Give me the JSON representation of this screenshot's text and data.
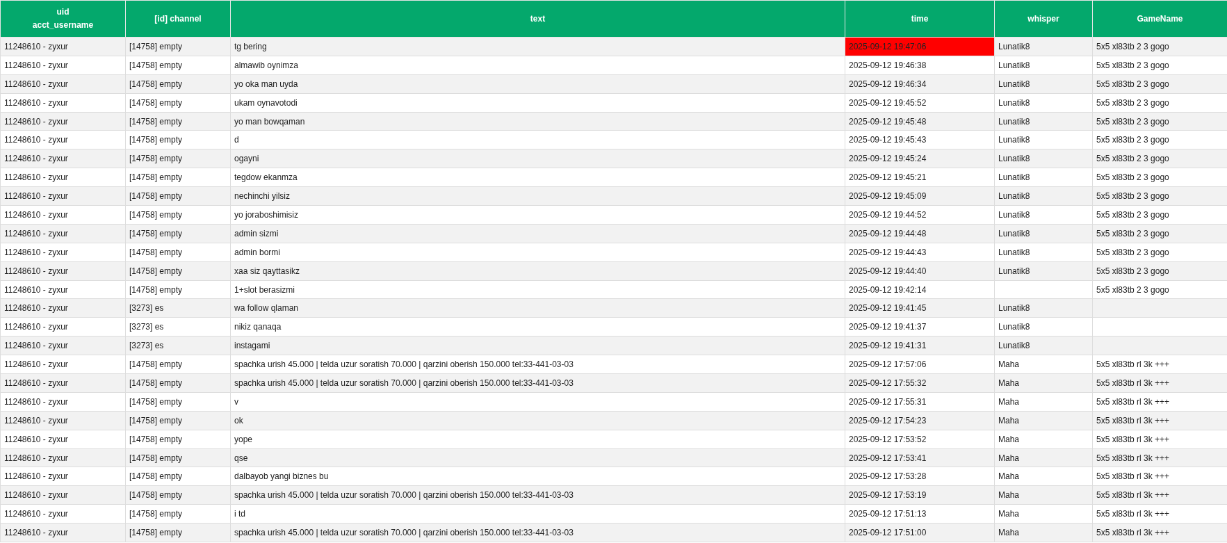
{
  "table": {
    "columns": [
      "uid\nacct_username",
      "[id] channel",
      "text",
      "time",
      "whisper",
      "GameName"
    ],
    "rows": [
      {
        "uid": "11248610 - zyxur",
        "channel": "[14758] empty",
        "text": "tg bering",
        "time": "2025-09-12 19:47:06",
        "time_flagged": true,
        "whisper": "Lunatik8",
        "game": "5x5 xl83tb 2 3 gogo"
      },
      {
        "uid": "11248610 - zyxur",
        "channel": "[14758] empty",
        "text": "almawib oynimza",
        "time": "2025-09-12 19:46:38",
        "time_flagged": false,
        "whisper": "Lunatik8",
        "game": "5x5 xl83tb 2 3 gogo"
      },
      {
        "uid": "11248610 - zyxur",
        "channel": "[14758] empty",
        "text": "yo oka man uyda",
        "time": "2025-09-12 19:46:34",
        "time_flagged": false,
        "whisper": "Lunatik8",
        "game": "5x5 xl83tb 2 3 gogo"
      },
      {
        "uid": "11248610 - zyxur",
        "channel": "[14758] empty",
        "text": "ukam oynavotodi",
        "time": "2025-09-12 19:45:52",
        "time_flagged": false,
        "whisper": "Lunatik8",
        "game": "5x5 xl83tb 2 3 gogo"
      },
      {
        "uid": "11248610 - zyxur",
        "channel": "[14758] empty",
        "text": "yo man bowqaman",
        "time": "2025-09-12 19:45:48",
        "time_flagged": false,
        "whisper": "Lunatik8",
        "game": "5x5 xl83tb 2 3 gogo"
      },
      {
        "uid": "11248610 - zyxur",
        "channel": "[14758] empty",
        "text": "d",
        "time": "2025-09-12 19:45:43",
        "time_flagged": false,
        "whisper": "Lunatik8",
        "game": "5x5 xl83tb 2 3 gogo"
      },
      {
        "uid": "11248610 - zyxur",
        "channel": "[14758] empty",
        "text": "ogayni",
        "time": "2025-09-12 19:45:24",
        "time_flagged": false,
        "whisper": "Lunatik8",
        "game": "5x5 xl83tb 2 3 gogo"
      },
      {
        "uid": "11248610 - zyxur",
        "channel": "[14758] empty",
        "text": "tegdow ekanmza",
        "time": "2025-09-12 19:45:21",
        "time_flagged": false,
        "whisper": "Lunatik8",
        "game": "5x5 xl83tb 2 3 gogo"
      },
      {
        "uid": "11248610 - zyxur",
        "channel": "[14758] empty",
        "text": "nechinchi yilsiz",
        "time": "2025-09-12 19:45:09",
        "time_flagged": false,
        "whisper": "Lunatik8",
        "game": "5x5 xl83tb 2 3 gogo"
      },
      {
        "uid": "11248610 - zyxur",
        "channel": "[14758] empty",
        "text": "yo joraboshimisiz",
        "time": "2025-09-12 19:44:52",
        "time_flagged": false,
        "whisper": "Lunatik8",
        "game": "5x5 xl83tb 2 3 gogo"
      },
      {
        "uid": "11248610 - zyxur",
        "channel": "[14758] empty",
        "text": "admin sizmi",
        "time": "2025-09-12 19:44:48",
        "time_flagged": false,
        "whisper": "Lunatik8",
        "game": "5x5 xl83tb 2 3 gogo"
      },
      {
        "uid": "11248610 - zyxur",
        "channel": "[14758] empty",
        "text": "admin bormi",
        "time": "2025-09-12 19:44:43",
        "time_flagged": false,
        "whisper": "Lunatik8",
        "game": "5x5 xl83tb 2 3 gogo"
      },
      {
        "uid": "11248610 - zyxur",
        "channel": "[14758] empty",
        "text": "xaa siz qayttasikz",
        "time": "2025-09-12 19:44:40",
        "time_flagged": false,
        "whisper": "Lunatik8",
        "game": "5x5 xl83tb 2 3 gogo"
      },
      {
        "uid": "11248610 - zyxur",
        "channel": "[14758] empty",
        "text": "1+slot berasizmi",
        "time": "2025-09-12 19:42:14",
        "time_flagged": false,
        "game": "5x5 xl83tb 2 3 gogo"
      },
      {
        "uid": "11248610 - zyxur",
        "channel": "[3273] es",
        "text": "wa follow qlaman",
        "time": "2025-09-12 19:41:45",
        "time_flagged": false,
        "whisper": "Lunatik8"
      },
      {
        "uid": "11248610 - zyxur",
        "channel": "[3273] es",
        "text": "nikiz qanaqa",
        "time": "2025-09-12 19:41:37",
        "time_flagged": false,
        "whisper": "Lunatik8"
      },
      {
        "uid": "11248610 - zyxur",
        "channel": "[3273] es",
        "text": "instagami",
        "time": "2025-09-12 19:41:31",
        "time_flagged": false,
        "whisper": "Lunatik8"
      },
      {
        "uid": "11248610 - zyxur",
        "channel": "[14758] empty",
        "text": "spachka urish 45.000 | telda uzur soratish 70.000 | qarzini oberish 150.000 tel:33-441-03-03",
        "time": "2025-09-12 17:57:06",
        "time_flagged": false,
        "whisper": "Maha",
        "game": "5x5 xl83tb rl 3k +++"
      },
      {
        "uid": "11248610 - zyxur",
        "channel": "[14758] empty",
        "text": "spachka urish 45.000 | telda uzur soratish 70.000 | qarzini oberish 150.000 tel:33-441-03-03",
        "time": "2025-09-12 17:55:32",
        "time_flagged": false,
        "whisper": "Maha",
        "game": "5x5 xl83tb rl 3k +++"
      },
      {
        "uid": "11248610 - zyxur",
        "channel": "[14758] empty",
        "text": "v",
        "time": "2025-09-12 17:55:31",
        "time_flagged": false,
        "whisper": "Maha",
        "game": "5x5 xl83tb rl 3k +++"
      },
      {
        "uid": "11248610 - zyxur",
        "channel": "[14758] empty",
        "text": "ok",
        "time": "2025-09-12 17:54:23",
        "time_flagged": false,
        "whisper": "Maha",
        "game": "5x5 xl83tb rl 3k +++"
      },
      {
        "uid": "11248610 - zyxur",
        "channel": "[14758] empty",
        "text": "yope",
        "time": "2025-09-12 17:53:52",
        "time_flagged": false,
        "whisper": "Maha",
        "game": "5x5 xl83tb rl 3k +++"
      },
      {
        "uid": "11248610 - zyxur",
        "channel": "[14758] empty",
        "text": "qse",
        "time": "2025-09-12 17:53:41",
        "time_flagged": false,
        "whisper": "Maha",
        "game": "5x5 xl83tb rl 3k +++"
      },
      {
        "uid": "11248610 - zyxur",
        "channel": "[14758] empty",
        "text": "dalbayob yangi biznes bu",
        "time": "2025-09-12 17:53:28",
        "time_flagged": false,
        "whisper": "Maha",
        "game": "5x5 xl83tb rl 3k +++"
      },
      {
        "uid": "11248610 - zyxur",
        "channel": "[14758] empty",
        "text": "spachka urish 45.000 | telda uzur soratish 70.000 | qarzini oberish 150.000 tel:33-441-03-03",
        "time": "2025-09-12 17:53:19",
        "time_flagged": false,
        "whisper": "Maha",
        "game": "5x5 xl83tb rl 3k +++"
      },
      {
        "uid": "11248610 - zyxur",
        "channel": "[14758] empty",
        "text": "i td",
        "time": "2025-09-12 17:51:13",
        "time_flagged": false,
        "whisper": "Maha",
        "game": "5x5 xl83tb rl 3k +++"
      },
      {
        "uid": "11248610 - zyxur",
        "channel": "[14758] empty",
        "text": "spachka urish 45.000 | telda uzur soratish 70.000 | qarzini oberish 150.000 tel:33-441-03-03",
        "time": "2025-09-12 17:51:00",
        "time_flagged": false,
        "whisper": "Maha",
        "game": "5x5 xl83tb rl 3k +++"
      }
    ]
  }
}
